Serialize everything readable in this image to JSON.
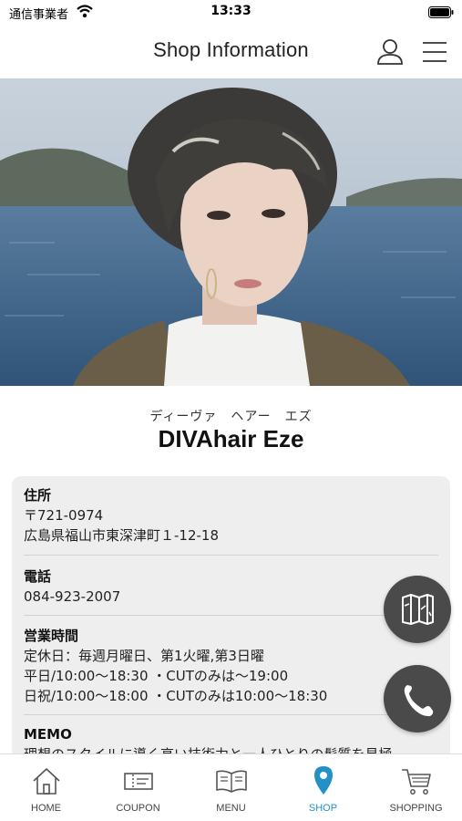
{
  "status": {
    "carrier": "通信事業者",
    "time": "13:33"
  },
  "header": {
    "title": "Shop Information"
  },
  "shop": {
    "kana": "ディーヴァ　ヘアー　エズ",
    "name": "DIVAhair Eze"
  },
  "info": {
    "address": {
      "heading": "住所",
      "postal": "〒721-0974",
      "street": "広島県福山市東深津町１-12-18"
    },
    "phone": {
      "heading": "電話",
      "number": "084-923-2007"
    },
    "hours": {
      "heading": "営業時間",
      "closed": "定休日：毎週月曜日、第1火曜,第3日曜",
      "weekday": "平日/10:00〜18:30 ・CUTのみは〜19:00",
      "holiday": "日祝/10:00〜18:00 ・CUTのみは10:00〜18:30"
    },
    "memo": {
      "heading": "MEMO",
      "text": "理想のスタイルに導く高い技術力と一人ひとりの髪質を見極"
    }
  },
  "tabs": [
    {
      "label": "HOME",
      "icon": "home-icon"
    },
    {
      "label": "COUPON",
      "icon": "coupon-icon"
    },
    {
      "label": "MENU",
      "icon": "menu-book-icon"
    },
    {
      "label": "SHOP",
      "icon": "map-pin-icon"
    },
    {
      "label": "SHOPPING",
      "icon": "shopping-cart-icon"
    }
  ],
  "active_tab": "SHOP",
  "colors": {
    "accent": "#2390c8",
    "fab": "#4a4a4a",
    "card": "#eeeeee"
  }
}
